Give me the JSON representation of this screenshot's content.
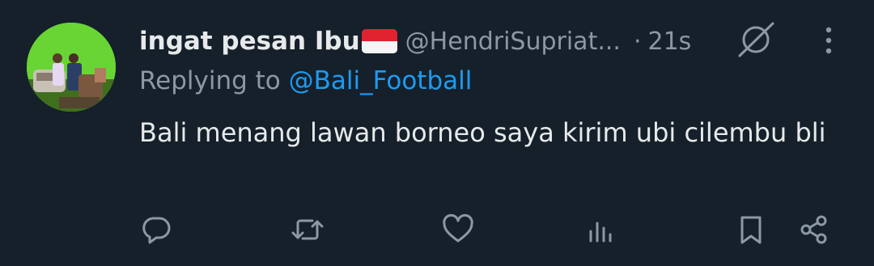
{
  "tweet": {
    "display_name": "ingat pesan Ibu",
    "handle": "@HendriSupriat...",
    "separator": "·",
    "time": "21s",
    "replying_prefix": "Replying to",
    "replying_to": "@Bali_Football",
    "text": "Bali menang lawan borneo saya kirim ubi cilembu bli"
  },
  "icons": {
    "avatar": "profile-photo",
    "flag": "indonesia-flag",
    "grok": "grok-icon",
    "more": "more-vertical-icon",
    "reply": "reply-icon",
    "retweet": "retweet-icon",
    "like": "heart-icon",
    "views": "analytics-icon",
    "bookmark": "bookmark-icon",
    "share": "share-icon"
  },
  "colors": {
    "background": "#15202b",
    "text": "#e7e9ea",
    "muted": "#8b98a5",
    "link": "#1d9bf0"
  }
}
